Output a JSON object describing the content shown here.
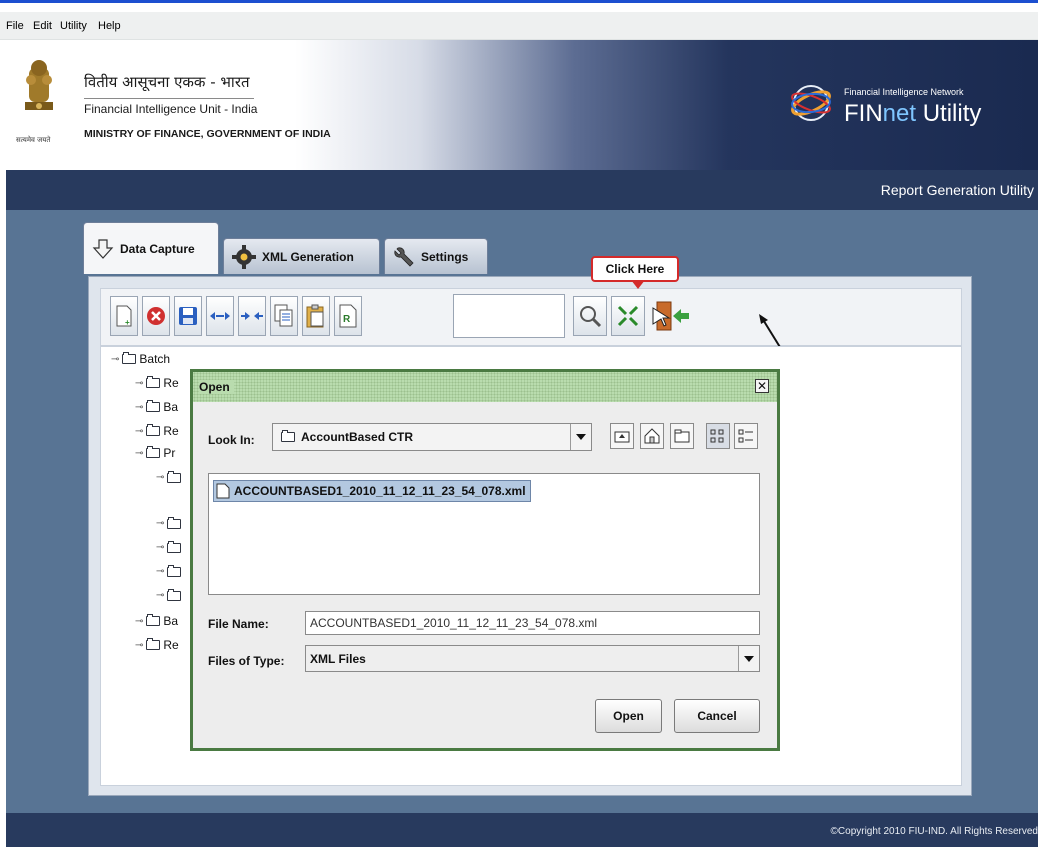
{
  "menu": {
    "items": [
      {
        "label": "File"
      },
      {
        "label": "Edit"
      },
      {
        "label": "Utility"
      },
      {
        "label": "Help"
      }
    ]
  },
  "header": {
    "hindi_title": "वितीय आसूचना एकक - भारत",
    "unit_name": "Financial Intelligence Unit - India",
    "ministry": "MINISTRY OF FINANCE, GOVERNMENT OF INDIA",
    "emblem_caption": "सत्यमेव जयते",
    "network_label": "Financial Intelligence Network",
    "product_prefix": "FIN",
    "product_mid": "net",
    "product_suffix": " Utility"
  },
  "titlebar": {
    "label": "Report Generation Utility"
  },
  "tabs": [
    {
      "label": "Data Capture",
      "icon": "down-arrow-icon",
      "active": true
    },
    {
      "label": "XML Generation",
      "icon": "gear-icon",
      "active": false
    },
    {
      "label": "Settings",
      "icon": "wrench-icon",
      "active": false
    }
  ],
  "toolbar": {
    "buttons": [
      "new-icon",
      "delete-icon",
      "save-icon",
      "expand-icon",
      "collapse-icon",
      "copy-icon",
      "paste-icon",
      "report-icon",
      "search-icon",
      "validate-icon",
      "exit-icon"
    ],
    "search_value": ""
  },
  "callout": {
    "label": "Click Here"
  },
  "tree": {
    "root": "Batch",
    "nodes": [
      "Re",
      "Ba",
      "Re",
      "Pr",
      "Ba",
      "Re"
    ]
  },
  "dialog": {
    "title": "Open",
    "look_in_label": "Look In:",
    "look_in_value": "AccountBased CTR",
    "files": [
      "ACCOUNTBASED1_2010_11_12_11_23_54_078.xml"
    ],
    "file_name_label": "File Name:",
    "file_name_value": "ACCOUNTBASED1_2010_11_12_11_23_54_078.xml",
    "file_type_label": "Files of Type:",
    "file_type_value": "XML Files",
    "open_label": "Open",
    "cancel_label": "Cancel"
  },
  "footer": {
    "copyright": "©Copyright 2010 FIU-IND. All Rights Reserved"
  }
}
